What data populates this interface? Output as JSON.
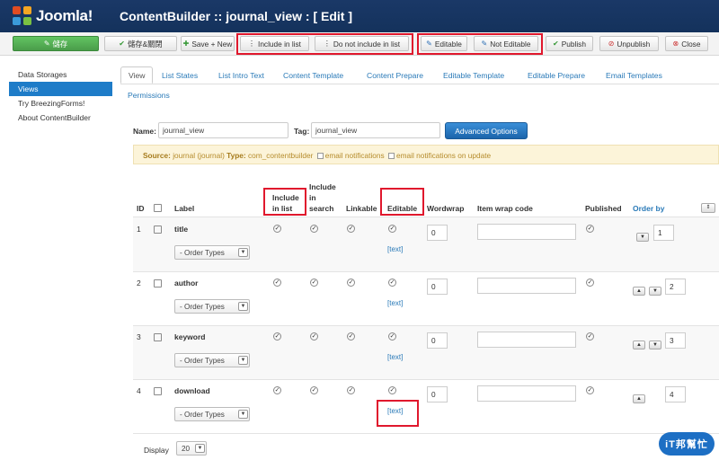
{
  "header": {
    "brand": "Joomla!",
    "title": "ContentBuilder :: journal_view : [ Edit ]",
    "brand_colors": [
      "#e04c22",
      "#f5a623",
      "#3a9ad9",
      "#7ac142"
    ]
  },
  "toolbar": {
    "save": "儲存",
    "save_close": "儲存&關閉",
    "save_new": "Save + New",
    "include_in_list": "Include in list",
    "not_include_in_list": "Do not include in list",
    "editable": "Editable",
    "not_editable": "Not Editable",
    "publish": "Publish",
    "unpublish": "Unpublish",
    "close": "Close"
  },
  "sidebar": {
    "items": [
      {
        "label": "Data Storages"
      },
      {
        "label": "Views"
      },
      {
        "label": "Try BreezingForms!"
      },
      {
        "label": "About ContentBuilder"
      }
    ]
  },
  "tabs": [
    {
      "label": "View"
    },
    {
      "label": "List States"
    },
    {
      "label": "List Intro Text"
    },
    {
      "label": "Content Template"
    },
    {
      "label": "Content Prepare"
    },
    {
      "label": "Editable Template"
    },
    {
      "label": "Editable Prepare"
    },
    {
      "label": "Email Templates"
    },
    {
      "label": "Permissions"
    }
  ],
  "form": {
    "name_label": "Name:",
    "name_value": "journal_view",
    "tag_label": "Tag:",
    "tag_value": "journal_view",
    "advanced_options": "Advanced Options"
  },
  "source": {
    "label": "Source:",
    "text1": "journal (journal)",
    "type_label": "Type:",
    "type_value": "com_contentbuilder",
    "opt1": "email notifications",
    "opt2": "email notifications on update"
  },
  "table": {
    "headers": {
      "id": "ID",
      "label": "Label",
      "include_in_list": "Include in list",
      "include_in_search": "Include in search",
      "linkable": "Linkable",
      "editable": "Editable",
      "wordwrap": "Wordwrap",
      "item_wrap_code": "Item wrap code",
      "published": "Published",
      "order_by": "Order by"
    },
    "rows": [
      {
        "id": "1",
        "label": "title",
        "order_types": "- Order Types",
        "wordwrap": "0",
        "order": "1",
        "edit_link": "[text]"
      },
      {
        "id": "2",
        "label": "author",
        "order_types": "- Order Types",
        "wordwrap": "0",
        "order": "2",
        "edit_link": "[text]"
      },
      {
        "id": "3",
        "label": "keyword",
        "order_types": "- Order Types",
        "wordwrap": "0",
        "order": "3",
        "edit_link": "[text]"
      },
      {
        "id": "4",
        "label": "download",
        "order_types": "- Order Types",
        "wordwrap": "0",
        "order": "4",
        "edit_link": "[text]"
      }
    ]
  },
  "footer": {
    "display_label": "Display",
    "display_value": "20"
  },
  "watermark": "iT邦幫忙"
}
